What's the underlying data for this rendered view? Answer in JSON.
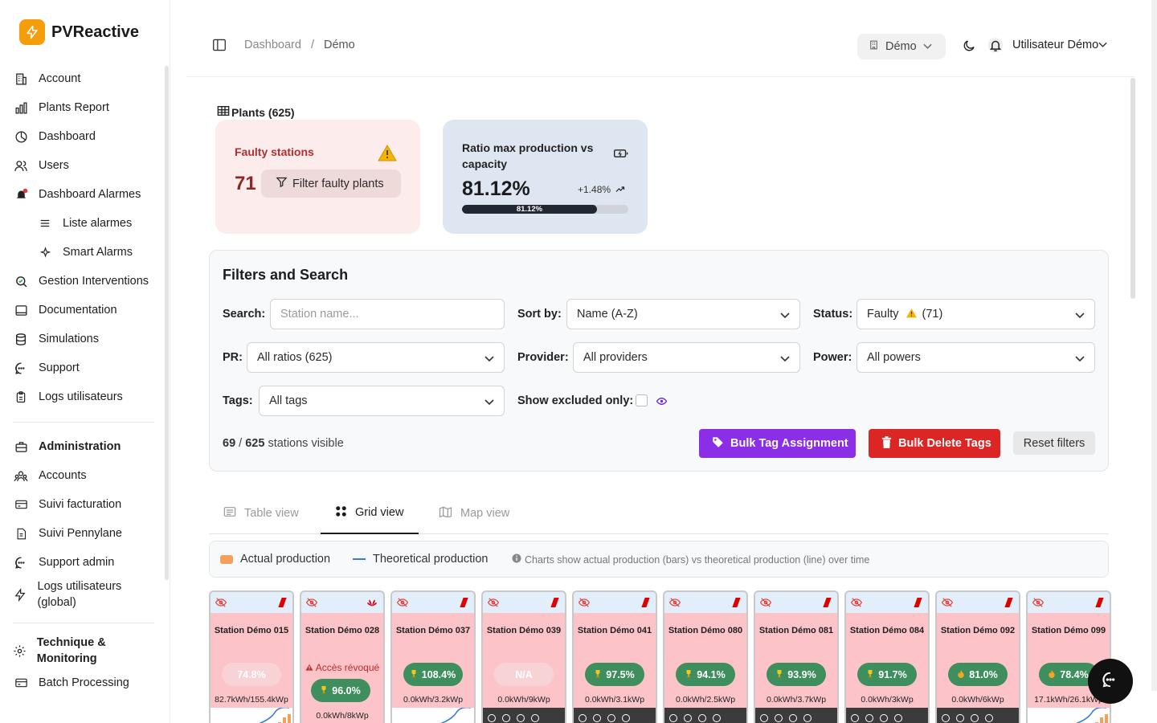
{
  "app": {
    "name": "PVReactive"
  },
  "sidebar": {
    "items": [
      {
        "label": "Account",
        "icon": "building-icon"
      },
      {
        "label": "Plants Report",
        "icon": "bar-chart-icon"
      },
      {
        "label": "Dashboard",
        "icon": "pie-chart-icon"
      },
      {
        "label": "Users",
        "icon": "users-icon"
      },
      {
        "label": "Dashboard Alarmes",
        "icon": "bell-alert-icon"
      },
      {
        "label": "Liste alarmes",
        "icon": "list-icon"
      },
      {
        "label": "Smart Alarms",
        "icon": "sparkles-icon"
      },
      {
        "label": "Gestion Interventions",
        "icon": "search-check-icon"
      },
      {
        "label": "Documentation",
        "icon": "book-icon"
      },
      {
        "label": "Simulations",
        "icon": "database-icon"
      },
      {
        "label": "Support",
        "icon": "chat-icon"
      },
      {
        "label": "Logs utilisateurs",
        "icon": "clipboard-icon"
      }
    ],
    "admin_items": [
      {
        "label": "Administration",
        "icon": "briefcase-icon"
      },
      {
        "label": "Accounts",
        "icon": "user-group-icon"
      },
      {
        "label": "Suivi facturation",
        "icon": "card-icon"
      },
      {
        "label": "Suivi Pennylane",
        "icon": "document-icon"
      },
      {
        "label": "Support admin",
        "icon": "chat-icon"
      },
      {
        "label": "Logs utilisateurs (global)",
        "icon": "bolt-icon"
      }
    ],
    "tech_items": [
      {
        "label": "Technique & Monitoring",
        "icon": "gear-icon"
      },
      {
        "label": "Batch Processing",
        "icon": "card-icon"
      }
    ]
  },
  "header": {
    "breadcrumb_root": "Dashboard",
    "breadcrumb_separator": "/",
    "breadcrumb_current": "Démo",
    "account_select": "Démo",
    "user_name": "Utilisateur Démo"
  },
  "plants": {
    "title": "Plants (625)"
  },
  "faulty_card": {
    "title": "Faulty stations",
    "count": "71",
    "button": "Filter faulty plants"
  },
  "ratio_card": {
    "title": "Ratio max production vs capacity",
    "value": "81.12%",
    "delta": "+1.48%",
    "bar_label": "81.12%",
    "bar_fraction": 0.8112
  },
  "filters": {
    "title": "Filters and Search",
    "search_label": "Search:",
    "search_placeholder": "Station name...",
    "sort_label": "Sort by:",
    "sort_value": "Name (A-Z)",
    "status_label": "Status:",
    "status_value": "Faulty",
    "status_count": "(71)",
    "pr_label": "PR:",
    "pr_value": "All ratios (625)",
    "provider_label": "Provider:",
    "provider_value": "All providers",
    "power_label": "Power:",
    "power_value": "All powers",
    "tags_label": "Tags:",
    "tags_value": "All tags",
    "excluded_label": "Show excluded only:",
    "visible_count": "69",
    "visible_sep": " / ",
    "visible_total": "625",
    "visible_suffix": " stations visible",
    "bulk_tag": "Bulk Tag Assignment",
    "bulk_delete": "Bulk Delete Tags",
    "reset": "Reset filters"
  },
  "tabs": [
    {
      "label": "Table view"
    },
    {
      "label": "Grid view"
    },
    {
      "label": "Map view"
    }
  ],
  "legend": {
    "actual": "Actual production",
    "theoretical": "Theoretical production",
    "info": "Charts show actual production (bars) vs theoretical production (line) over time"
  },
  "stations": [
    {
      "name": "Station Démo 015",
      "ratio": "74.8%",
      "energy": "82.7kWh/155.4kWp",
      "provider": "red"
    },
    {
      "name": "Station Démo 028",
      "revoked": "Accès révoqué",
      "ratio": "96.0%",
      "energy": "0.0kWh/8kWp",
      "provider": "huawei"
    },
    {
      "name": "Station Démo 037",
      "ratio": "108.4%",
      "energy": "0.0kWh/3.2kWp",
      "provider": "red"
    },
    {
      "name": "Station Démo 039",
      "ratio": "N/A",
      "energy": "0.0kWh/9kWp",
      "provider": "red"
    },
    {
      "name": "Station Démo 041",
      "ratio": "97.5%",
      "energy": "0.0kWh/3.1kWp",
      "provider": "red"
    },
    {
      "name": "Station Démo 080",
      "ratio": "94.1%",
      "energy": "0.0kWh/2.5kWp",
      "provider": "red"
    },
    {
      "name": "Station Démo 081",
      "ratio": "93.9%",
      "energy": "0.0kWh/3.7kWp",
      "provider": "red"
    },
    {
      "name": "Station Démo 084",
      "ratio": "91.7%",
      "energy": "0.0kWh/3kWp",
      "provider": "red"
    },
    {
      "name": "Station Démo 092",
      "ratio": "81.0%",
      "energy": "0.0kWh/6kWp",
      "provider": "red"
    },
    {
      "name": "Station Démo 099",
      "ratio": "78.4%",
      "energy": "17.1kWh/26.1kWp",
      "provider": "red"
    }
  ]
}
